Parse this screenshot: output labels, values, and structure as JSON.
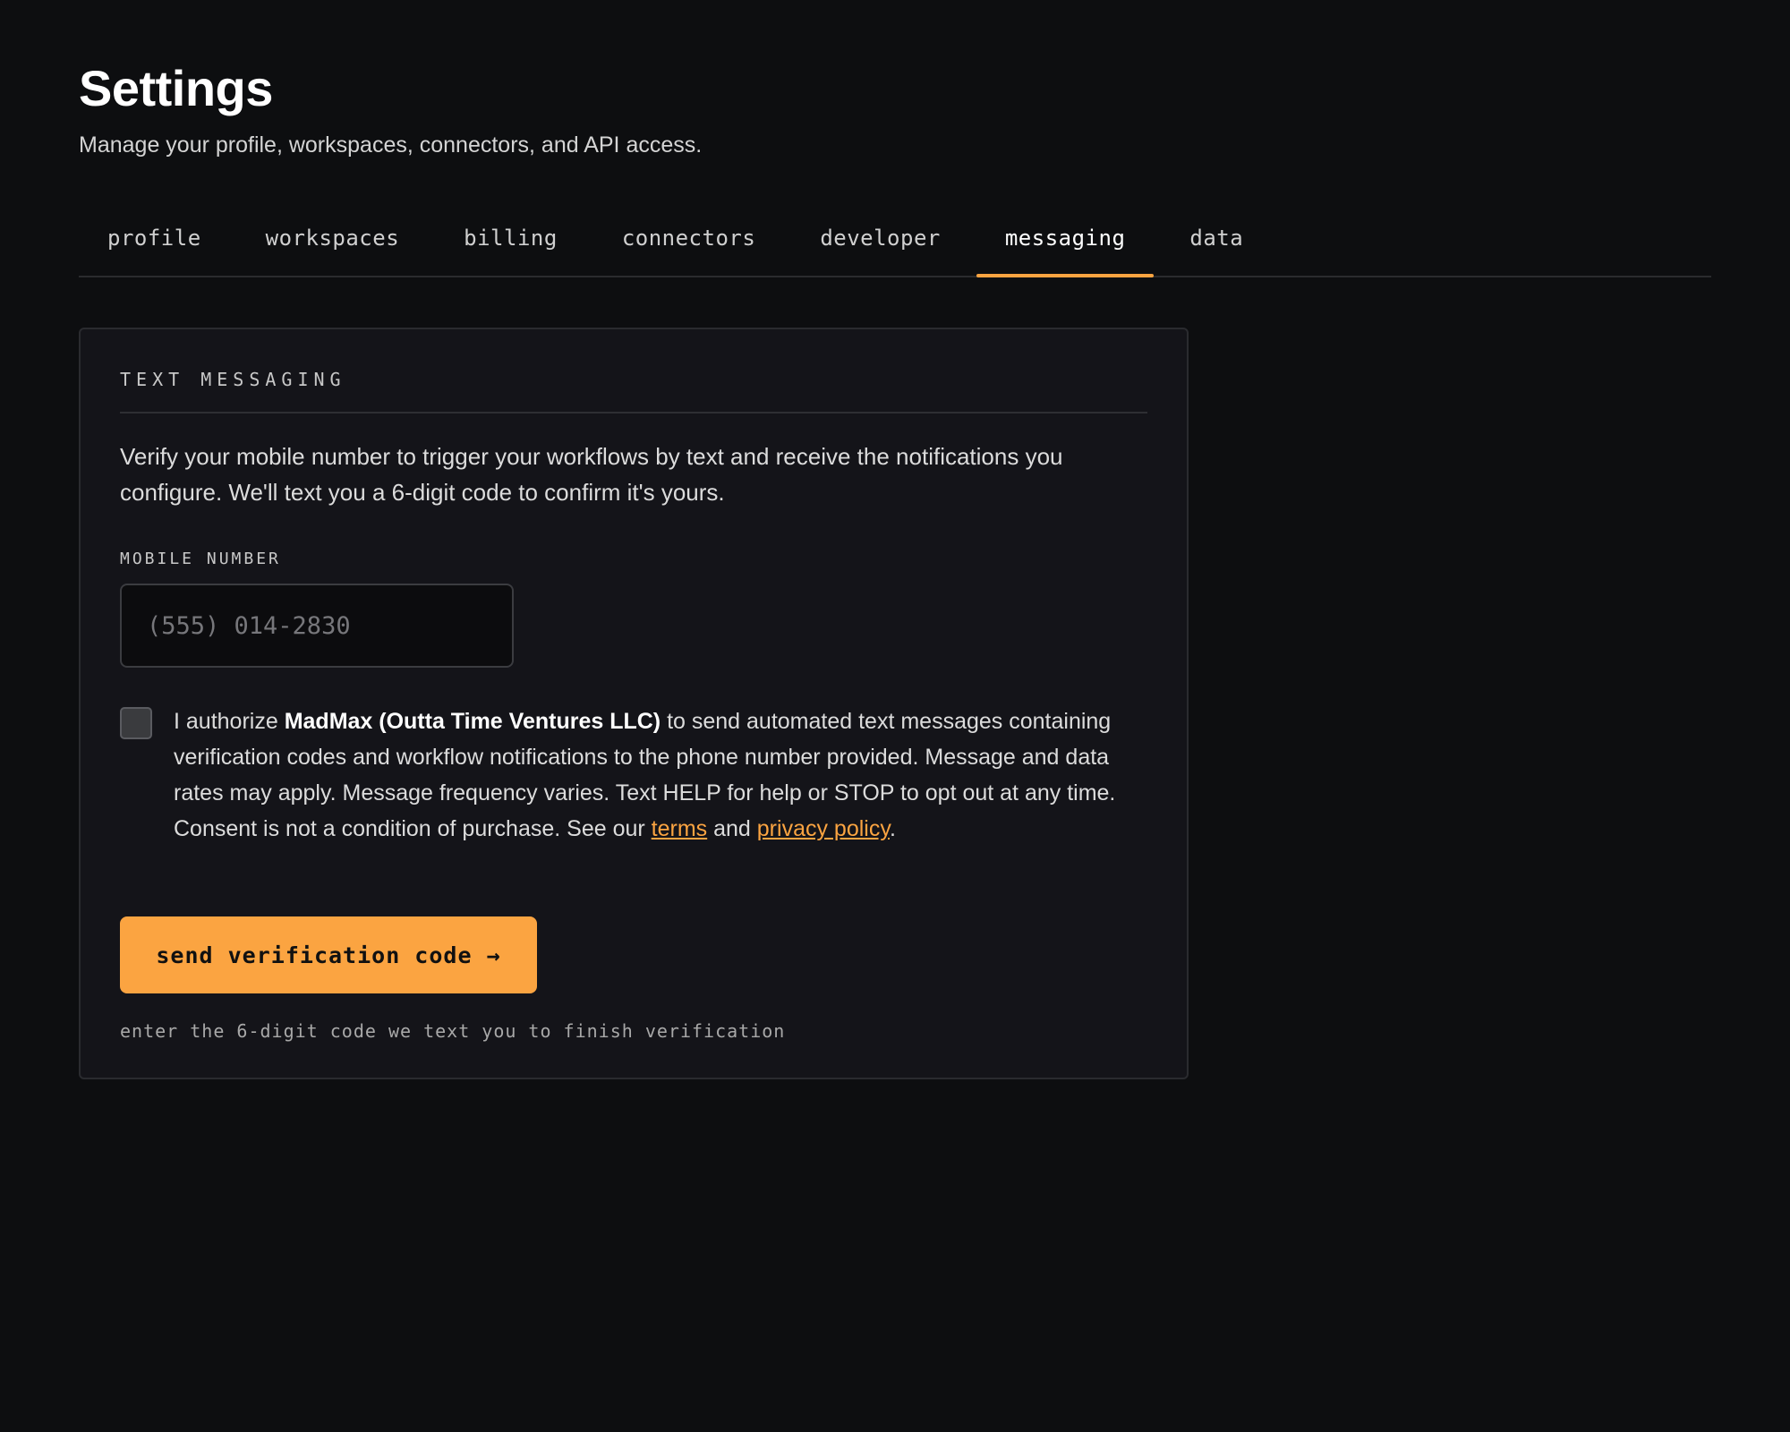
{
  "header": {
    "title": "Settings",
    "subtitle": "Manage your profile, workspaces, connectors, and API access."
  },
  "tabs": [
    {
      "label": "profile",
      "active": false
    },
    {
      "label": "workspaces",
      "active": false
    },
    {
      "label": "billing",
      "active": false
    },
    {
      "label": "connectors",
      "active": false
    },
    {
      "label": "developer",
      "active": false
    },
    {
      "label": "messaging",
      "active": true
    },
    {
      "label": "data",
      "active": false
    }
  ],
  "messaging": {
    "section_title": "TEXT MESSAGING",
    "description": "Verify your mobile number to trigger your workflows by text and receive the notifications you configure. We'll text you a 6-digit code to confirm it's yours.",
    "mobile_label": "MOBILE NUMBER",
    "mobile_value": "",
    "mobile_placeholder": "(555) 014-2830",
    "consent_checked": false,
    "consent": {
      "prefix": "I authorize ",
      "company": "MadMax (Outta Time Ventures LLC)",
      "body": " to send automated text messages containing verification codes and workflow notifications to the phone number provided. Message and data rates may apply. Message frequency varies. Text HELP for help or STOP to opt out at any time. Consent is not a condition of purchase. See our ",
      "terms_link": "terms",
      "and": " and ",
      "privacy_link": "privacy policy",
      "suffix": "."
    },
    "send_button": "send verification code →",
    "helper": "enter the 6-digit code we text you to finish verification"
  },
  "colors": {
    "background": "#0d0e10",
    "card": "#141419",
    "accent": "#fba441"
  }
}
